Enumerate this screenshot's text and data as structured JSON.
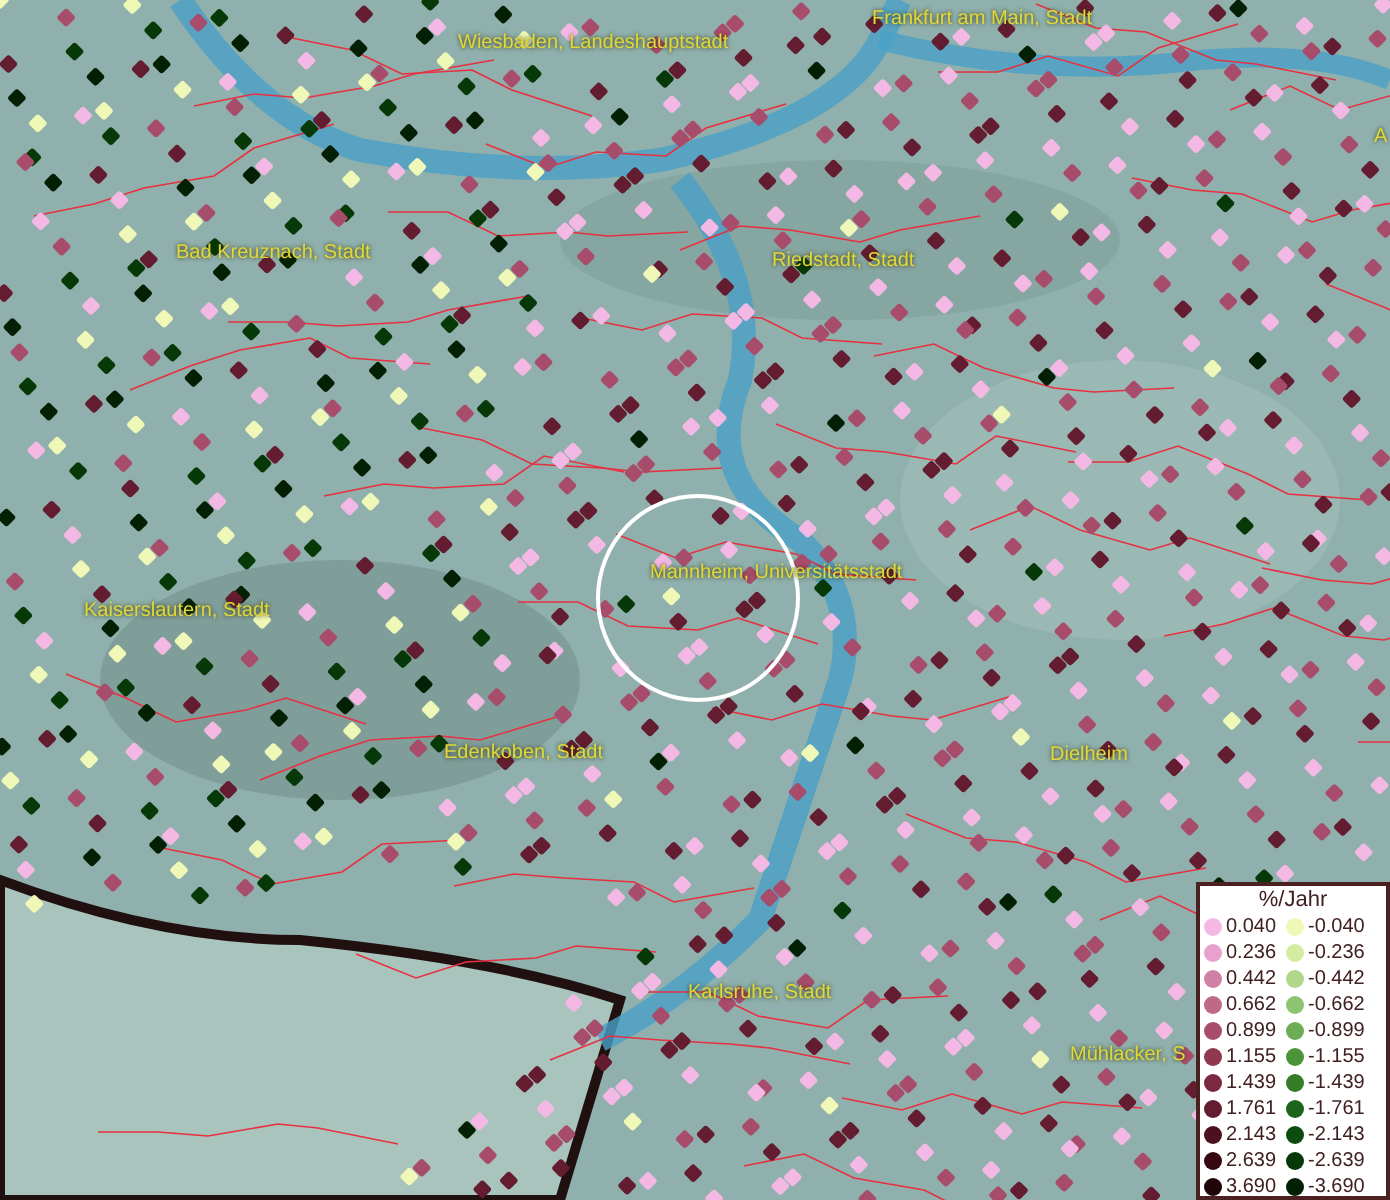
{
  "map": {
    "labels": [
      {
        "text": "Wiesbaden, Landeshauptstadt"
      },
      {
        "text": "Frankfurt am Main, Stadt"
      },
      {
        "text": "A"
      },
      {
        "text": "Bad Kreuznach, Stadt"
      },
      {
        "text": "Riedstadt, Stadt"
      },
      {
        "text": "Mannheim, Universitätsstadt"
      },
      {
        "text": "Kaiserslautern, Stadt"
      },
      {
        "text": "Edenkoben, Stadt"
      },
      {
        "text": "Dielheim"
      },
      {
        "text": "Karlsruhe, Stadt"
      },
      {
        "text": "Mühlacker, S"
      }
    ]
  },
  "legend": {
    "title": "%/Jahr",
    "rows": [
      {
        "positive": {
          "value": "0.040",
          "color": "#f4b8e4"
        },
        "negative": {
          "value": "-0.040",
          "color": "#f0f8b8"
        }
      },
      {
        "positive": {
          "value": "0.236",
          "color": "#e8a0cc"
        },
        "negative": {
          "value": "-0.236",
          "color": "#d4eca0"
        }
      },
      {
        "positive": {
          "value": "0.442",
          "color": "#d080a4"
        },
        "negative": {
          "value": "-0.442",
          "color": "#b0d888"
        }
      },
      {
        "positive": {
          "value": "0.662",
          "color": "#c06888"
        },
        "negative": {
          "value": "-0.662",
          "color": "#8cc470"
        }
      },
      {
        "positive": {
          "value": "0.899",
          "color": "#a84c6c"
        },
        "negative": {
          "value": "-0.899",
          "color": "#6cac54"
        }
      },
      {
        "positive": {
          "value": "1.155",
          "color": "#903850"
        },
        "negative": {
          "value": "-1.155",
          "color": "#4c9438"
        }
      },
      {
        "positive": {
          "value": "1.439",
          "color": "#7c2840"
        },
        "negative": {
          "value": "-1.439",
          "color": "#347c28"
        }
      },
      {
        "positive": {
          "value": "1.761",
          "color": "#641c30"
        },
        "negative": {
          "value": "-1.761",
          "color": "#1c641c"
        }
      },
      {
        "positive": {
          "value": "2.143",
          "color": "#4c1020"
        },
        "negative": {
          "value": "-2.143",
          "color": "#0c4c10"
        }
      },
      {
        "positive": {
          "value": "2.639",
          "color": "#380810"
        },
        "negative": {
          "value": "-2.639",
          "color": "#063808"
        }
      },
      {
        "positive": {
          "value": "3.690",
          "color": "#200408"
        },
        "negative": {
          "value": "-3.690",
          "color": "#042004"
        }
      }
    ]
  }
}
